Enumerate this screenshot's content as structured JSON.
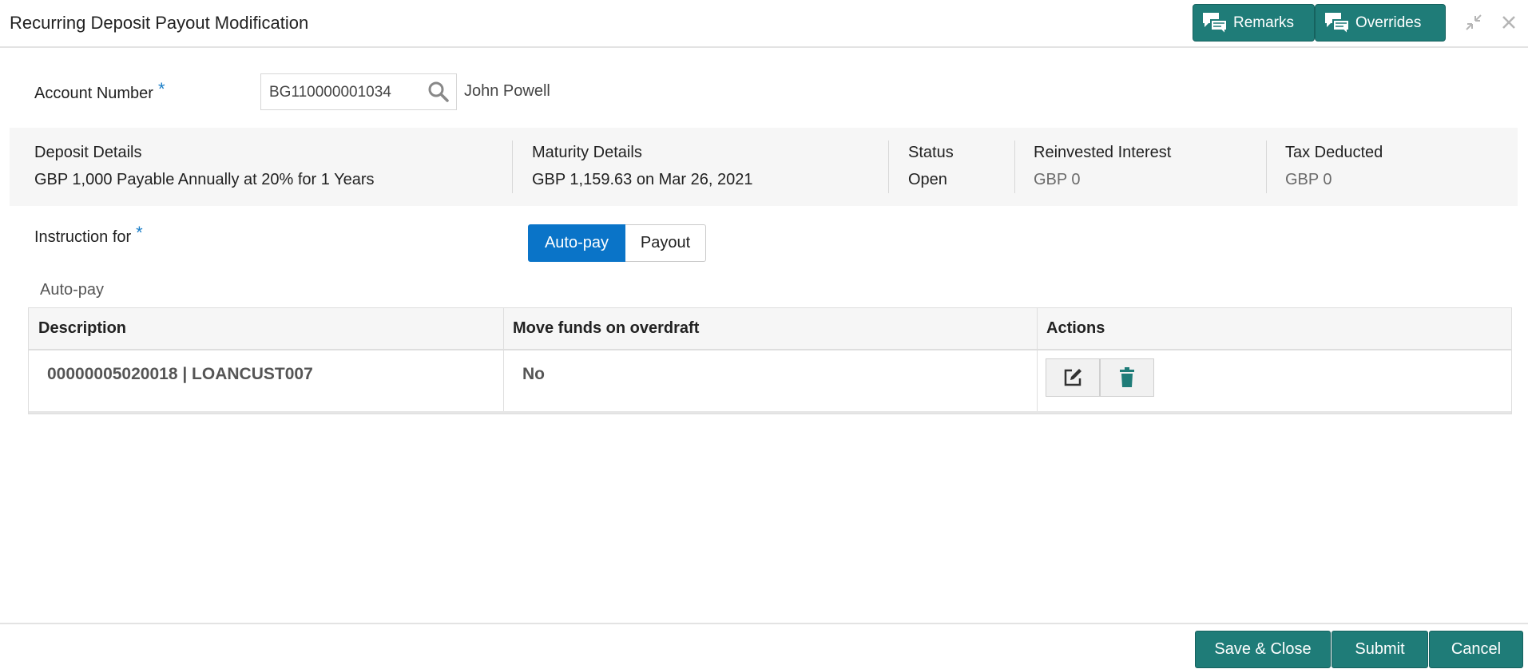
{
  "header": {
    "title": "Recurring Deposit Payout Modification",
    "remarks_label": "Remarks",
    "overrides_label": "Overrides",
    "accent_color": "#1f7c78"
  },
  "account": {
    "label": "Account Number",
    "required_marker": "*",
    "value": "BG110000001034",
    "customer_name": "John Powell"
  },
  "deposit_details": {
    "deposit": {
      "heading": "Deposit Details",
      "value": "GBP 1,000 Payable Annually at 20% for 1 Years"
    },
    "maturity": {
      "heading": "Maturity Details",
      "value": "GBP 1,159.63 on Mar 26, 2021"
    },
    "status": {
      "heading": "Status",
      "value": "Open"
    },
    "reinvested": {
      "heading": "Reinvested Interest",
      "value": "GBP 0"
    },
    "tax": {
      "heading": "Tax Deducted",
      "value": "GBP 0"
    }
  },
  "instruction": {
    "label": "Instruction for",
    "required_marker": "*",
    "options": [
      "Auto-pay",
      "Payout"
    ],
    "selected": "Auto-pay",
    "selected_color": "#0a74c8"
  },
  "autopay": {
    "section_title": "Auto-pay",
    "columns": [
      "Description",
      "Move funds on overdraft",
      "Actions"
    ],
    "rows": [
      {
        "description": "00000005020018 | LOANCUST007",
        "move_funds": "No"
      }
    ],
    "row_actions": [
      "edit-icon",
      "delete-icon"
    ]
  },
  "footer": {
    "save_close_label": "Save & Close",
    "submit_label": "Submit",
    "cancel_label": "Cancel"
  }
}
